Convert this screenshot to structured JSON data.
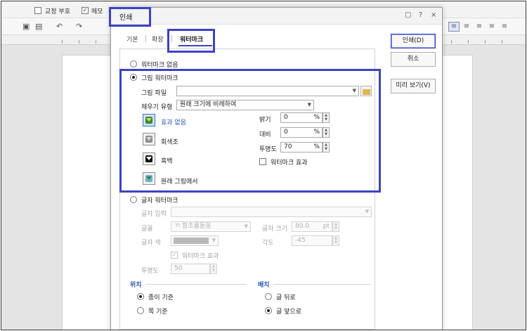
{
  "background": {
    "checkbox_correction_label": "교정 부호",
    "checkbox_memo_label": "메모",
    "checkbox_memo_checked": true,
    "toolbar_icons": [
      "printer-icon",
      "print-preview-icon",
      "undo-icon",
      "redo-icon"
    ],
    "align_icons": [
      "align-justify-icon",
      "align-left-icon",
      "align-center-icon",
      "align-right-icon",
      "align-distribute-icon"
    ]
  },
  "dialog": {
    "title": "인쇄",
    "title_icons": [
      "help-chat-icon",
      "question-icon",
      "close-icon"
    ],
    "help_label": "?",
    "close_label": "×",
    "tabs": [
      {
        "label": "기본",
        "active": false
      },
      {
        "label": "확장",
        "active": false
      },
      {
        "label": "워터마크",
        "active": true
      }
    ],
    "buttons": {
      "print": "인쇄(D)",
      "cancel": "취소",
      "preview": "미리 보기(V)"
    },
    "watermark": {
      "none_label": "워터마크 없음",
      "image": {
        "label": "그림 워터마크",
        "selected": true,
        "file_label": "그림 파일",
        "file_value": "",
        "fill_label": "채우기 유형",
        "fill_value": "원래 크기에 비례하여",
        "effects": [
          {
            "label": "효과 없음",
            "icon": "no-effect-icon",
            "selected": true
          },
          {
            "label": "회색조",
            "icon": "grayscale-icon",
            "selected": false
          },
          {
            "label": "흑백",
            "icon": "black-white-icon",
            "selected": false
          },
          {
            "label": "원래 그림에서",
            "icon": "original-picture-icon",
            "selected": false
          }
        ],
        "brightness_label": "밝기",
        "brightness_value": "0",
        "contrast_label": "대비",
        "contrast_value": "0",
        "transparency_label": "투명도",
        "transparency_value": "70",
        "percent_unit": "%",
        "watermark_effect_label": "워터마크 효과",
        "watermark_effect_checked": false
      },
      "text": {
        "label": "글자 워터마크",
        "selected": false,
        "input_label": "글자 입력",
        "input_value": "",
        "font_label": "글꼴",
        "font_value": "함초롬돋움",
        "font_prefix": "ㄲ",
        "size_label": "글자 크기",
        "size_value": "80.0",
        "size_unit": "pt",
        "color_label": "글자 색",
        "color_swatch": "#b8b8b8",
        "angle_label": "각도",
        "angle_value": "-45",
        "watermark_effect_label": "워터마크 효과",
        "watermark_effect_checked": true,
        "transparency_label": "투명도",
        "transparency_value": "50"
      },
      "position": {
        "title": "위치",
        "options": [
          {
            "label": "종이 기준",
            "selected": true
          },
          {
            "label": "쪽 기준",
            "selected": false
          }
        ]
      },
      "arrangement": {
        "title": "배치",
        "options": [
          {
            "label": "글 뒤로",
            "selected": false
          },
          {
            "label": "글 앞으로",
            "selected": true
          }
        ]
      }
    }
  },
  "colors": {
    "highlight": "#3c43c4",
    "accent_text": "#2a56b8"
  }
}
